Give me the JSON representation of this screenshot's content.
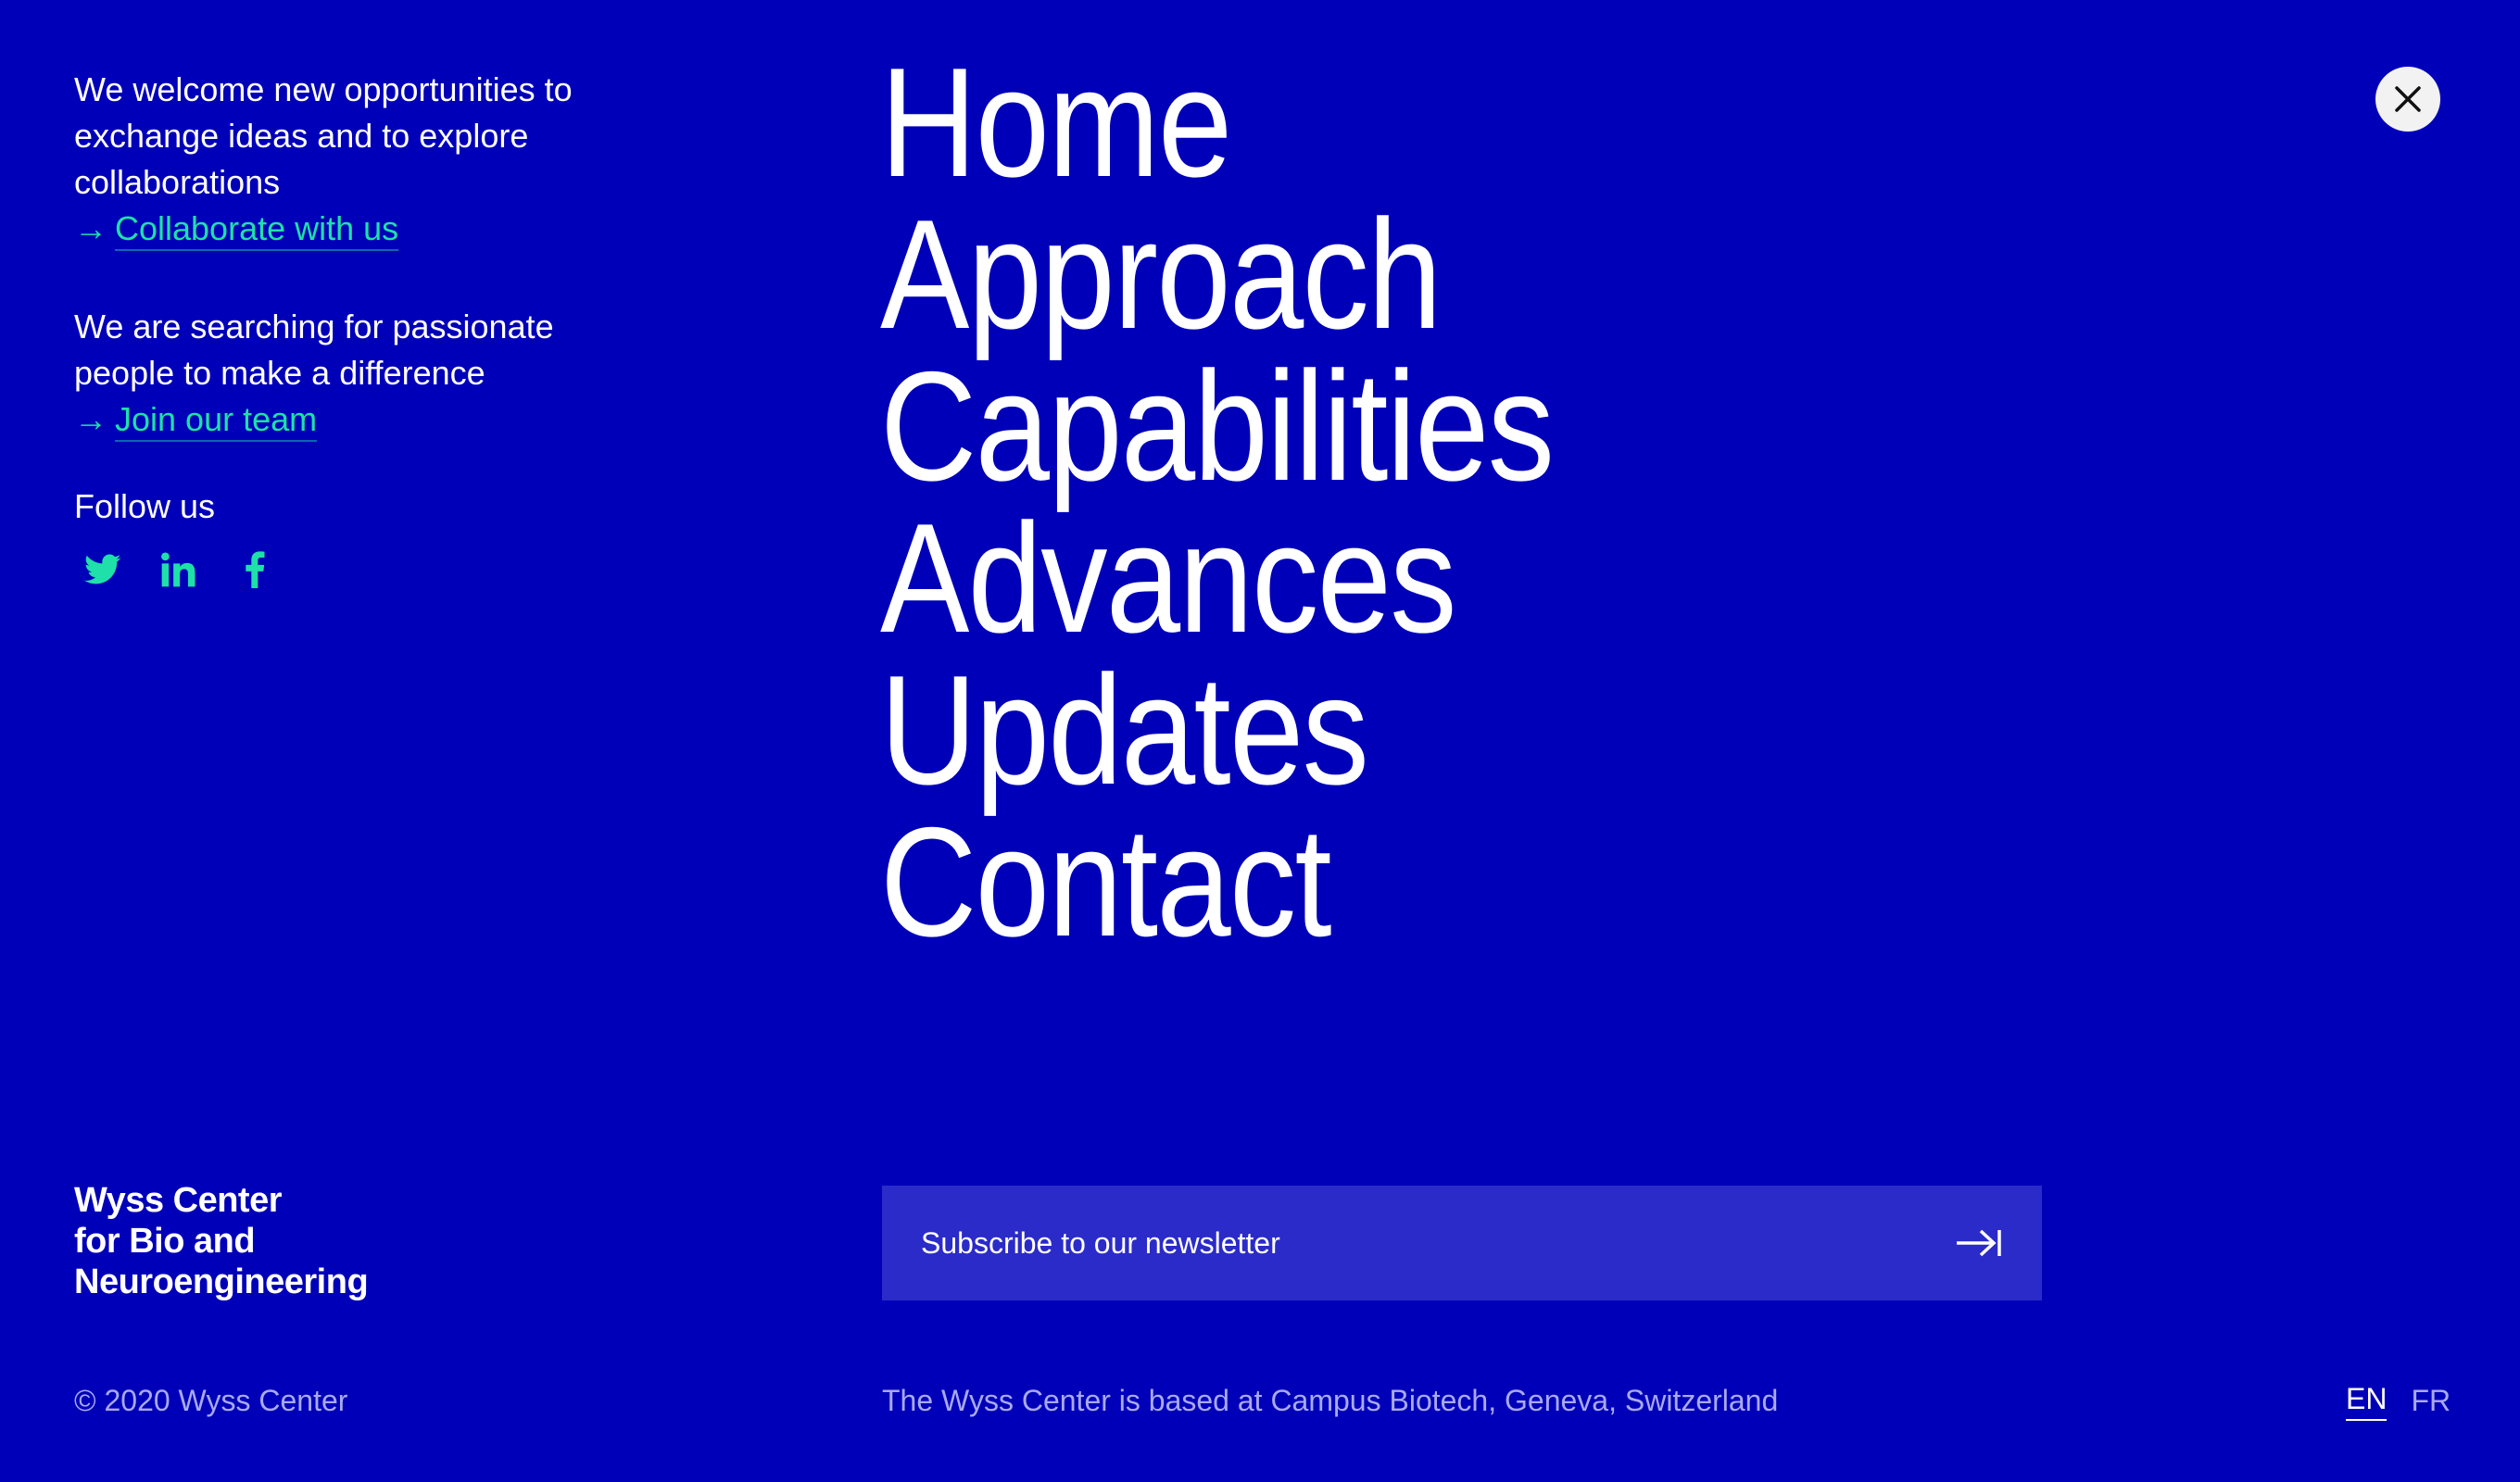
{
  "collaborate": {
    "text": "We welcome new opportunities to exchange ideas and to explore collaborations",
    "link_arrow": "→",
    "link_label": "Collaborate with us"
  },
  "careers": {
    "text": "We are searching for passionate people to make a difference",
    "link_arrow": "→",
    "link_label": "Join our team"
  },
  "social": {
    "label": "Follow us",
    "items": [
      {
        "icon": "twitter-icon"
      },
      {
        "icon": "linkedin-icon"
      },
      {
        "icon": "facebook-icon"
      }
    ]
  },
  "nav": {
    "items": [
      {
        "label": "Home"
      },
      {
        "label": "Approach"
      },
      {
        "label": "Capabilities"
      },
      {
        "label": "Advances"
      },
      {
        "label": "Updates"
      },
      {
        "label": "Contact"
      }
    ]
  },
  "close": {
    "icon": "close-icon"
  },
  "logo": {
    "line1": "Wyss Center",
    "line2": "for Bio and",
    "line3": "Neuroengineering"
  },
  "newsletter": {
    "placeholder": "Subscribe to our newsletter",
    "submit_icon": "arrow-right-to-bar-icon"
  },
  "footer": {
    "copyright": "© 2020 Wyss Center",
    "location": "The Wyss Center is based at Campus Biotech, Geneva, Switzerland",
    "languages": [
      {
        "label": "EN",
        "active": true
      },
      {
        "label": "FR",
        "active": false
      }
    ]
  },
  "colors": {
    "background": "#0000B8",
    "accent": "#1FE0A8",
    "muted_text": "#A9A9F0",
    "input_bg": "#2B2BC9"
  }
}
